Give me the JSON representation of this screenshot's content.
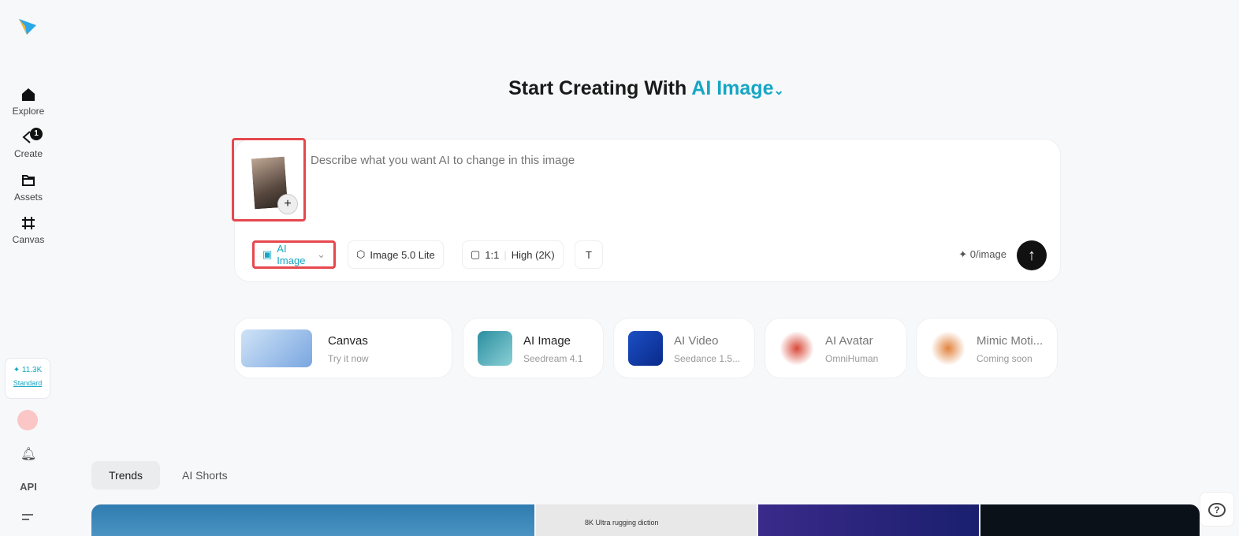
{
  "sidebar": {
    "items": [
      {
        "label": "Explore"
      },
      {
        "label": "Create",
        "badge": "1"
      },
      {
        "label": "Assets"
      },
      {
        "label": "Canvas"
      }
    ],
    "credits": "✦ 11.3K",
    "plan": "Standard",
    "api": "API"
  },
  "header": {
    "prefix": "Start Creating With",
    "mode": "AI Image",
    "chevron": "⌄"
  },
  "prompt": {
    "placeholder": "Describe what you want AI to change in this image",
    "add": "+",
    "mode": "AI Image",
    "model": "Image 5.0 Lite",
    "ratio": "1:1",
    "quality": "High (2K)",
    "cost": "✦ 0/image",
    "send": "↑"
  },
  "cards": [
    {
      "title": "Canvas",
      "sub": "Try it now"
    },
    {
      "title": "AI Image",
      "sub": "Seedream 4.1"
    },
    {
      "title": "AI Video",
      "sub": "Seedance 1.5..."
    },
    {
      "title": "AI Avatar",
      "sub": "OmniHuman"
    },
    {
      "title": "Mimic Moti...",
      "sub": "Coming soon"
    }
  ],
  "tabs": [
    "Trends",
    "AI Shorts"
  ],
  "gallery_caption": "8K Ultra rugging diction",
  "help": "?"
}
